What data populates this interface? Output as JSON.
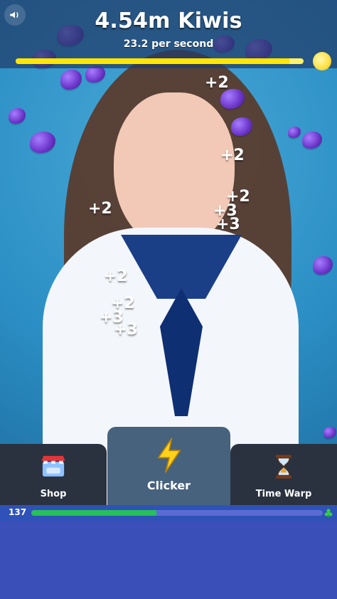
{
  "header": {
    "title": "4.54m Kiwis",
    "rate": "23.2 per second",
    "progress_fraction": 0.95,
    "progress_color": "#ffe600"
  },
  "floating_popups": [
    "+2",
    "+2",
    "+2",
    "+2",
    "+3",
    "+3",
    "+2",
    "+2",
    "+3",
    "+3"
  ],
  "nav": {
    "shop_label": "Shop",
    "clicker_label": "Clicker",
    "time_warp_label": "Time Warp",
    "active": "Clicker"
  },
  "status": {
    "count": "137",
    "progress_fraction": 0.43,
    "progress_color": "#27c05a"
  },
  "icons": {
    "volume": "volume-icon",
    "sun": "sun-icon",
    "shop": "shop-icon",
    "clicker": "lightning-icon",
    "time_warp": "hourglass-icon",
    "clover": "clover-icon"
  }
}
